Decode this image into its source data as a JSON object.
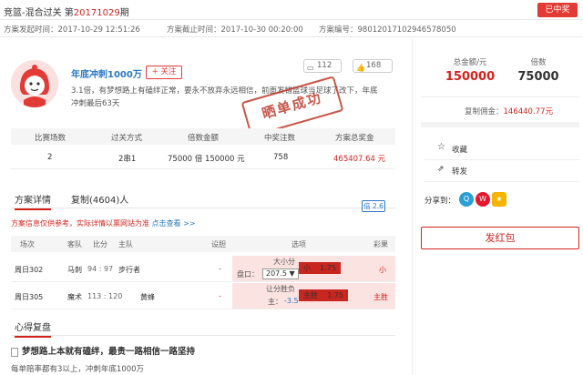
{
  "header": {
    "title_prefix": "竞篮-混合过关  第",
    "issue": "20171029",
    "title_suffix": "期",
    "status_button": "已中奖"
  },
  "meta": {
    "start_time": "方案发起时间：2017-10-29 12:51:26",
    "end_time": "方案截止时间：2017-10-30 00:20:00",
    "plan_no": "方案编号：98012017102946578050"
  },
  "user": {
    "name": "年底冲刺1000万",
    "follow_label": "+ 关注",
    "comment_count": "112",
    "like_count": "168",
    "description": "3.1倍，有梦想路上有磕绊正常，要永不放弃永远相信，前面发错篮球当足球了改下，年底冲刺最后63天",
    "stamp_text": "晒单成功"
  },
  "summary": {
    "headers": [
      "比赛场数",
      "过关方式",
      "倍数金额",
      "中奖注数",
      "方案总奖金"
    ],
    "values": [
      "2",
      "2串1",
      "75000 倍  150000 元",
      "758",
      "465407.64 元"
    ]
  },
  "tabs": {
    "detail": "方案详情",
    "copy": "复制(4604)人",
    "badge": "倍 2.6"
  },
  "notice": {
    "text": "方案信息仅供参考，实际详情以票网站为准 ",
    "link": "点击查看 >>"
  },
  "table": {
    "headers": [
      "场次",
      "客队",
      "比分",
      "主队",
      "设胆",
      "选项",
      "彩果"
    ],
    "rows": [
      {
        "match": "周日302",
        "away": "马刺",
        "score": "94 : 97",
        "home": "步行者",
        "banker": "-",
        "option_title": "大小分",
        "option_label": "盘口：",
        "option_value": "207.5 ▼",
        "pick": "小",
        "odds": "1.75",
        "result": "小"
      },
      {
        "match": "周日305",
        "away": "魔术",
        "score": "113 : 120",
        "home": "黄蜂",
        "banker": "-",
        "option_title": "让分胜负",
        "option_label": "主：",
        "option_value": "-3.5",
        "pick": "主胜",
        "odds": "1.75",
        "result": "主胜"
      }
    ]
  },
  "post": {
    "section_title": "心得复盘",
    "title": "梦想路上本就有磕绊，最贵一路相信一路坚持",
    "sub": "每单赔率都有3以上，冲刺年底1000万"
  },
  "sidebar": {
    "total_label": "总金额/元",
    "total_value": "150000",
    "multiple_label": "倍数",
    "multiple_value": "75000",
    "copy_fee_label": "复制佣金：",
    "copy_fee_value": "146440.77元",
    "collect": "收藏",
    "forward": "转发",
    "share_label": "分享到：",
    "red_packet": "发红包"
  }
}
